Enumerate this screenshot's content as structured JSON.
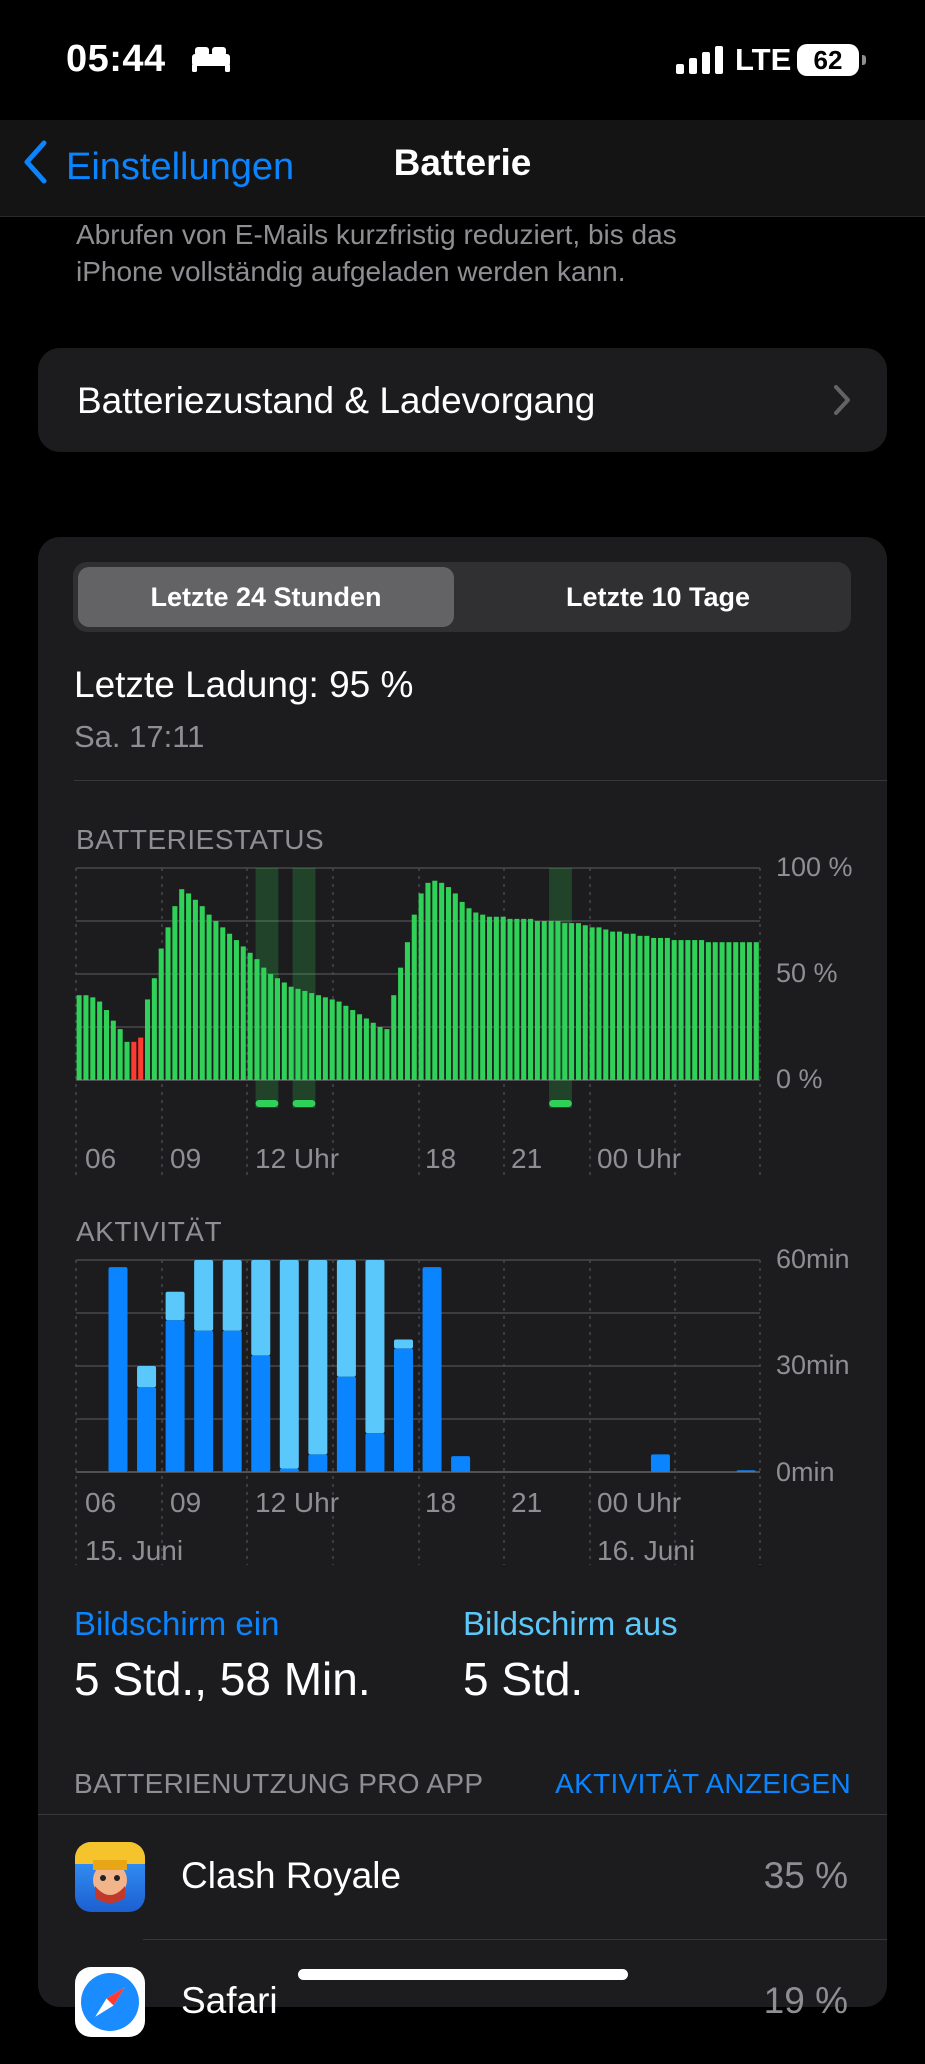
{
  "status_bar": {
    "time": "05:44",
    "network": "LTE",
    "battery_level": "62",
    "icons": [
      "bed-icon",
      "signal-bars-icon",
      "battery-icon"
    ]
  },
  "nav": {
    "back_label": "Einstellungen",
    "title": "Batterie"
  },
  "intro_text_line1": "Abrufen von E-Mails kurzfristig reduziert, bis das",
  "intro_text_line2": "iPhone vollständig aufgeladen werden kann.",
  "health_row": {
    "label": "Batteriezustand & Ladevorgang"
  },
  "segmented": {
    "options": [
      "Letzte 24 Stunden",
      "Letzte 10 Tage"
    ],
    "selected": "Letzte 24 Stunden"
  },
  "last_charge": {
    "label": "Letzte Ladung: 95 %",
    "date": "Sa. 17:11"
  },
  "battery_chart": {
    "header": "BATTERIESTATUS",
    "y_labels": [
      "100 %",
      "50 %",
      "0 %"
    ],
    "x_labels": [
      "06",
      "09",
      "12 Uhr",
      "18",
      "21",
      "00 Uhr"
    ]
  },
  "activity_chart": {
    "header": "AKTIVITÄT",
    "y_labels": [
      "60min",
      "30min",
      "0min"
    ],
    "x_labels": [
      "06",
      "09",
      "12 Uhr",
      "18",
      "21",
      "00 Uhr"
    ],
    "date_labels": [
      "15. Juni",
      "16. Juni"
    ]
  },
  "screen_stats": {
    "on_label": "Bildschirm ein",
    "on_value": "5 Std., 58 Min.",
    "off_label": "Bildschirm aus",
    "off_value": "5 Std."
  },
  "app_usage": {
    "header": "BATTERIENUTZUNG PRO APP",
    "link": "AKTIVITÄT ANZEIGEN",
    "apps": [
      {
        "name": "Clash Royale",
        "percent": "35 %"
      },
      {
        "name": "Safari",
        "percent": "19 %"
      }
    ]
  },
  "colors": {
    "accent": "#0a84ff",
    "battery_green": "#30d158",
    "battery_low_red": "#ff3b30",
    "screen_on_blue": "#0a84ff",
    "screen_off_lightblue": "#5ac8fa"
  },
  "chart_data": [
    {
      "type": "bar",
      "title": "BATTERIESTATUS",
      "xlabel": "",
      "ylabel": "",
      "ylim": [
        0,
        100
      ],
      "x_ticks": [
        "06",
        "09",
        "12 Uhr",
        "18",
        "21",
        "00 Uhr"
      ],
      "values": [
        40,
        40,
        39,
        37,
        33,
        28,
        24,
        18,
        18,
        20,
        38,
        48,
        62,
        72,
        82,
        90,
        88,
        85,
        82,
        78,
        75,
        72,
        69,
        66,
        63,
        60,
        57,
        53,
        50,
        48,
        46,
        44,
        43,
        42,
        41,
        40,
        39,
        38,
        37,
        35,
        33,
        31,
        29,
        27,
        25,
        24,
        40,
        53,
        65,
        78,
        88,
        93,
        94,
        93,
        91,
        88,
        84,
        81,
        79,
        78,
        77,
        77,
        77,
        76,
        76,
        76,
        76,
        75,
        75,
        75,
        75,
        74,
        74,
        74,
        73,
        72,
        72,
        71,
        70,
        70,
        69,
        69,
        68,
        68,
        67,
        67,
        67,
        66,
        66,
        66,
        66,
        66,
        65,
        65,
        65,
        65,
        65,
        65,
        65,
        65
      ],
      "low_indices": [
        8,
        9
      ],
      "charging_ranges": [
        [
          6.3,
          7.1
        ],
        [
          7.6,
          8.4
        ],
        [
          16.6,
          17.4
        ]
      ],
      "grid": true
    },
    {
      "type": "bar",
      "title": "AKTIVITÄT",
      "ylim": [
        0,
        60
      ],
      "x_ticks": [
        "06",
        "09",
        "12 Uhr",
        "18",
        "21",
        "00 Uhr"
      ],
      "series": [
        {
          "name": "Bildschirm ein",
          "values": [
            58,
            24,
            43,
            40,
            40,
            33,
            1,
            5,
            27,
            11,
            35,
            58,
            4.5,
            0,
            0,
            0,
            0,
            0,
            0,
            5,
            0,
            0,
            0.5
          ]
        },
        {
          "name": "Bildschirm aus",
          "values": [
            0,
            6,
            8,
            20,
            20,
            27,
            59,
            55,
            33,
            49,
            2.5,
            0,
            0,
            0,
            0,
            0,
            0,
            0,
            0,
            0,
            0,
            0,
            0
          ]
        }
      ]
    }
  ]
}
